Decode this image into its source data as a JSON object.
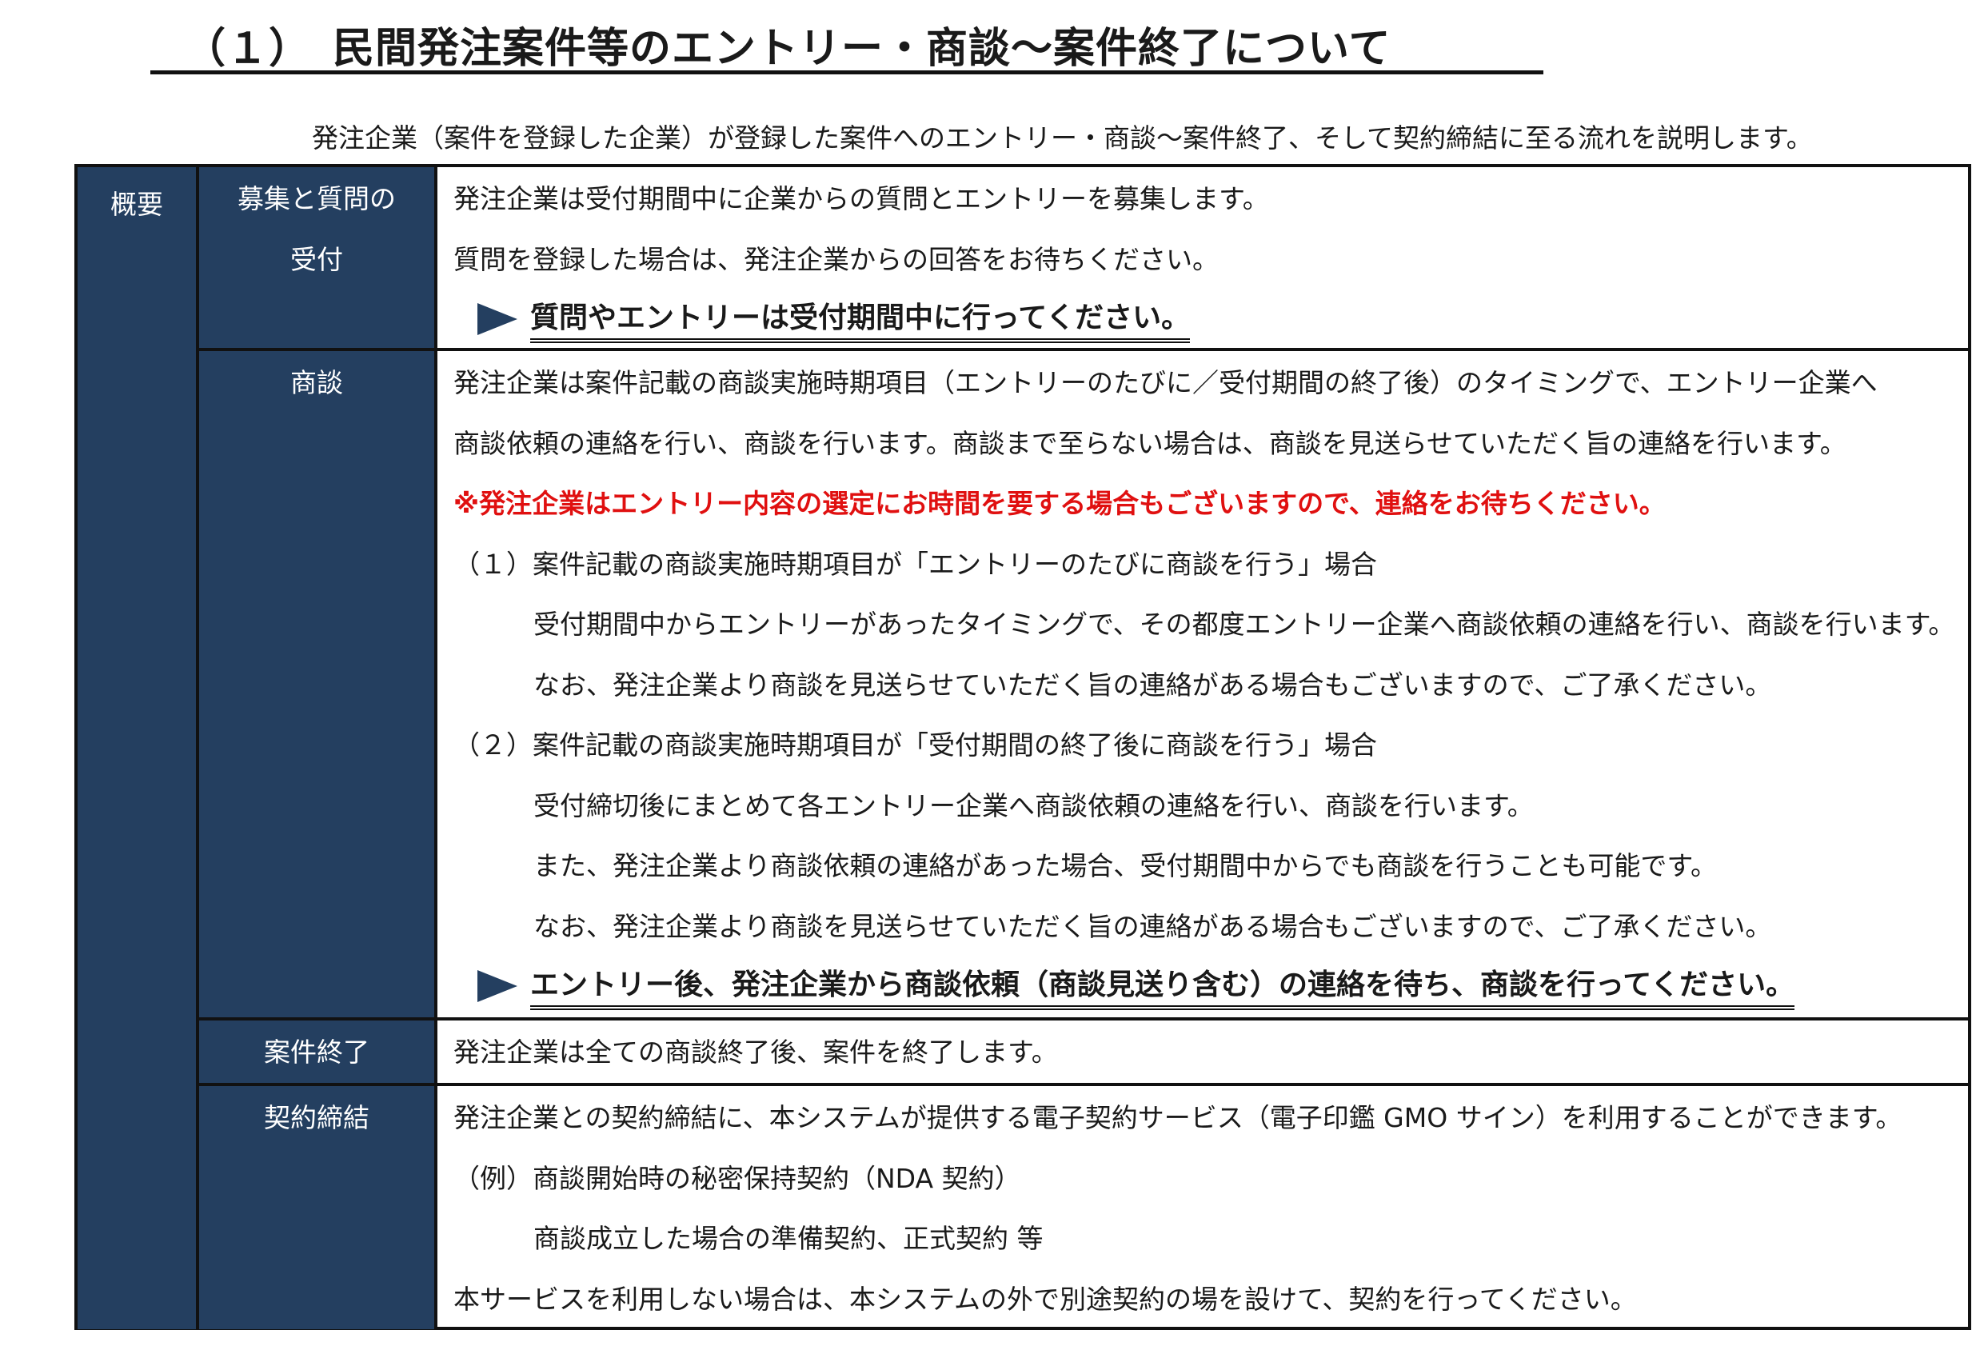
{
  "header": {
    "title": "（１）　民間発注案件等のエントリー・商談～案件終了について",
    "intro": "発注企業（案件を登録した企業）が登録した案件へのエントリー・商談～案件終了、そして契約締結に至る流れを説明します。"
  },
  "table": {
    "overview_label": "概要",
    "sections": [
      {
        "label_lines": [
          "募集と質問の",
          "受付"
        ],
        "lines": [
          "発注企業は受付期間中に企業からの質問とエントリーを募集します。",
          "質問を登録した場合は、発注企業からの回答をお待ちください。"
        ],
        "emphasis": "質問やエントリーは受付期間中に行ってください。"
      },
      {
        "label_lines": [
          "商談"
        ],
        "lines": [
          "発注企業は案件記載の商談実施時期項目（エントリーのたびに／受付期間の終了後）のタイミングで、エントリー企業へ",
          "商談依頼の連絡を行い、商談を行います。商談まで至らない場合は、商談を見送らせていただく旨の連絡を行います。"
        ],
        "warning": "※発注企業はエントリー内容の選定にお時間を要する場合もございますので、連絡をお待ちください。",
        "case1_heading": "（１）案件記載の商談実施時期項目が「エントリーのたびに商談を行う」場合",
        "case1_lines": [
          "受付期間中からエントリーがあったタイミングで、その都度エントリー企業へ商談依頼の連絡を行い、商談を行います。",
          "なお、発注企業より商談を見送らせていただく旨の連絡がある場合もございますので、ご了承ください。"
        ],
        "case2_heading": "（２）案件記載の商談実施時期項目が「受付期間の終了後に商談を行う」場合",
        "case2_lines": [
          "受付締切後にまとめて各エントリー企業へ商談依頼の連絡を行い、商談を行います。",
          "また、発注企業より商談依頼の連絡があった場合、受付期間中からでも商談を行うことも可能です。",
          "なお、発注企業より商談を見送らせていただく旨の連絡がある場合もございますので、ご了承ください。"
        ],
        "emphasis": "エントリー後、発注企業から商談依頼（商談見送り含む）の連絡を待ち、商談を行ってください。"
      },
      {
        "label_lines": [
          "案件終了"
        ],
        "lines": [
          "発注企業は全ての商談終了後、案件を終了します。"
        ]
      },
      {
        "label_lines": [
          "契約締結"
        ],
        "lines": [
          "発注企業との契約締結に、本システムが提供する電子契約サービス（電子印鑑 GMO サイン）を利用することができます。"
        ],
        "example_heading": "（例）商談開始時の秘密保持契約（NDA 契約）",
        "example_lines": [
          "商談成立した場合の準備契約、正式契約 等"
        ],
        "closing": "本サービスを利用しない場合は、本システムの外で別途契約の場を設けて、契約を行ってください。"
      }
    ]
  },
  "colors": {
    "label_background": "#243f60",
    "warning_text": "#e01010",
    "border": "#111111"
  },
  "icons": {
    "emphasis_marker": "triangle-right-icon"
  }
}
